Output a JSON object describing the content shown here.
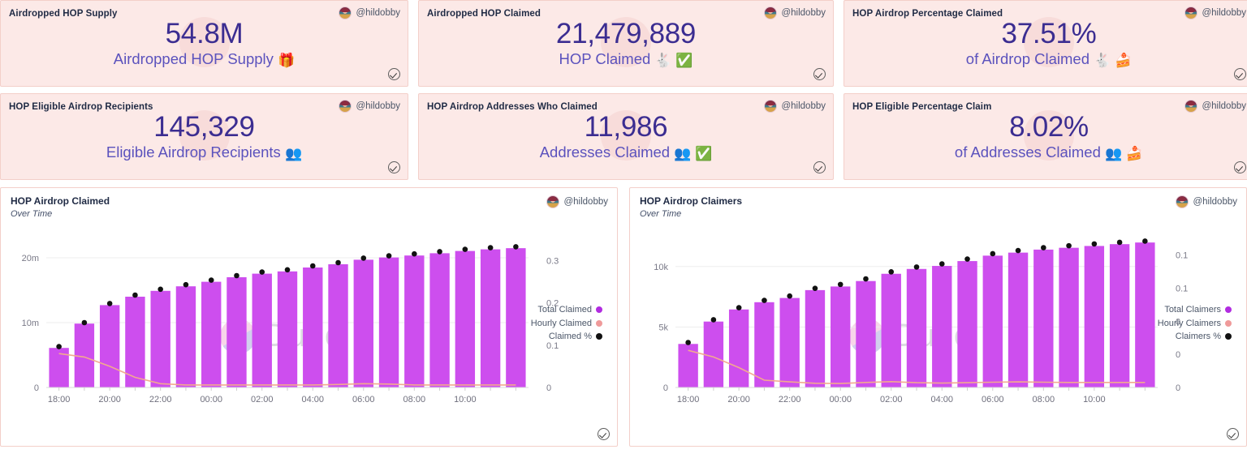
{
  "attribution": {
    "handle": "@hildobby",
    "avatar_icon": "user-avatar"
  },
  "kpis": [
    {
      "title": "Airdropped HOP Supply",
      "value": "54.8M",
      "subtitle": "Airdropped HOP Supply",
      "emojis": "🎁"
    },
    {
      "title": "Airdropped HOP Claimed",
      "value": "21,479,889",
      "subtitle": "HOP Claimed",
      "emojis": "🐇 ✅"
    },
    {
      "title": "HOP Airdrop Percentage Claimed",
      "value": "37.51%",
      "subtitle": "of Airdrop Claimed",
      "emojis": "🐇 🍰"
    },
    {
      "title": "HOP Eligible Airdrop Recipients",
      "value": "145,329",
      "subtitle": "Eligible Airdrop Recipients",
      "emojis": "👥"
    },
    {
      "title": "HOP Airdrop Addresses Who Claimed",
      "value": "11,986",
      "subtitle": "Addresses Claimed",
      "emojis": "👥 ✅"
    },
    {
      "title": "HOP Eligible Percentage Claim",
      "value": "8.02%",
      "subtitle": "of Addresses Claimed",
      "emojis": "👥 🍰"
    }
  ],
  "watermark": {
    "text": "Dune"
  },
  "colors": {
    "card_background": "#fce9e7",
    "card_border": "#f3cfc9",
    "value_text": "#3b2d91",
    "subtitle_text": "#5b52bd",
    "bar": "#cd4eee",
    "line": "#f2a98f",
    "dot": "#111111"
  },
  "charts": [
    {
      "title": "HOP Airdrop Claimed",
      "subtitle": "Over Time",
      "legend": [
        {
          "label": "Total Claimed",
          "color": "#b12ce0"
        },
        {
          "label": "Hourly Claimed",
          "color": "#ef9a9a"
        },
        {
          "label": "Claimed %",
          "color": "#111111"
        }
      ]
    },
    {
      "title": "HOP Airdrop Claimers",
      "subtitle": "Over Time",
      "legend": [
        {
          "label": "Total Claimers",
          "color": "#b12ce0"
        },
        {
          "label": "Hourly Claimers",
          "color": "#ef9a9a"
        },
        {
          "label": "Claimers %",
          "color": "#111111"
        }
      ]
    }
  ],
  "chart_data": [
    {
      "type": "bar",
      "title": "HOP Airdrop Claimed",
      "subtitle": "Over Time",
      "xlabel": "",
      "ylabel": "",
      "grid": true,
      "legend_position": "right",
      "x": [
        "18:00",
        "19:00",
        "20:00",
        "21:00",
        "22:00",
        "23:00",
        "00:00",
        "01:00",
        "02:00",
        "03:00",
        "04:00",
        "05:00",
        "06:00",
        "07:00",
        "08:00",
        "09:00",
        "10:00",
        "11:00",
        "12:00"
      ],
      "xtick_labels": [
        "18:00",
        "20:00",
        "22:00",
        "00:00",
        "02:00",
        "04:00",
        "06:00",
        "08:00",
        "10:00"
      ],
      "left_axis": {
        "ticks": [
          0,
          10000000,
          20000000
        ],
        "tick_labels": [
          "0",
          "10m",
          "20m"
        ],
        "range": [
          0,
          23500000
        ]
      },
      "right_axis": {
        "ticks": [
          0,
          0.1,
          0.2,
          0.3
        ],
        "tick_labels": [
          "0",
          "0.1",
          "0.2",
          "0.3"
        ],
        "range": [
          0,
          0.36
        ]
      },
      "series": [
        {
          "name": "Total Claimed",
          "type": "bar",
          "color": "#cd4eee",
          "axis": "left",
          "values": [
            6100000,
            9850000,
            12700000,
            14000000,
            14900000,
            15600000,
            16300000,
            17000000,
            17550000,
            17900000,
            18500000,
            19000000,
            19700000,
            20050000,
            20350000,
            20700000,
            21050000,
            21300000,
            21479889
          ]
        },
        {
          "name": "Hourly Claimed",
          "type": "line",
          "color": "#f2a98f",
          "axis": "right",
          "values": [
            0.08,
            0.072,
            0.05,
            0.024,
            0.009,
            0.006,
            0.006,
            0.006,
            0.006,
            0.006,
            0.006,
            0.007,
            0.009,
            0.008,
            0.006,
            0.006,
            0.006,
            0.006,
            0.006
          ]
        },
        {
          "name": "Claimed %",
          "type": "scatter",
          "color": "#111111",
          "axis": "left",
          "values": [
            6300000,
            10000000,
            12950000,
            14250000,
            15150000,
            15850000,
            16550000,
            17250000,
            17800000,
            18150000,
            18750000,
            19250000,
            19950000,
            20300000,
            20600000,
            20950000,
            21300000,
            21550000,
            21700000
          ]
        }
      ]
    },
    {
      "type": "bar",
      "title": "HOP Airdrop Claimers",
      "subtitle": "Over Time",
      "xlabel": "",
      "ylabel": "",
      "grid": true,
      "legend_position": "right",
      "x": [
        "18:00",
        "19:00",
        "20:00",
        "21:00",
        "22:00",
        "23:00",
        "00:00",
        "01:00",
        "02:00",
        "03:00",
        "04:00",
        "05:00",
        "06:00",
        "07:00",
        "08:00",
        "09:00",
        "10:00",
        "11:00",
        "12:00"
      ],
      "xtick_labels": [
        "18:00",
        "20:00",
        "22:00",
        "00:00",
        "02:00",
        "04:00",
        "06:00",
        "08:00",
        "10:00"
      ],
      "left_axis": {
        "ticks": [
          0,
          5000,
          10000
        ],
        "tick_labels": [
          "0",
          "5k",
          "10k"
        ],
        "range": [
          0,
          12600
        ]
      },
      "right_axis": {
        "ticks": [
          0,
          0.025,
          0.05,
          0.075,
          0.1
        ],
        "tick_labels": [
          "0",
          "0",
          "0",
          "0.1",
          "0.1"
        ],
        "range": [
          0,
          0.115
        ]
      },
      "series": [
        {
          "name": "Total Claimers",
          "type": "bar",
          "color": "#cd4eee",
          "axis": "left",
          "values": [
            3600,
            5450,
            6450,
            7050,
            7400,
            8050,
            8350,
            8800,
            9400,
            9800,
            10050,
            10450,
            10900,
            11150,
            11400,
            11550,
            11700,
            11850,
            11986
          ]
        },
        {
          "name": "Hourly Claimers",
          "type": "line",
          "color": "#f2a98f",
          "axis": "right",
          "values": [
            0.028,
            0.023,
            0.015,
            0.0055,
            0.0042,
            0.0032,
            0.003,
            0.0038,
            0.0044,
            0.0036,
            0.0033,
            0.0036,
            0.004,
            0.0042,
            0.004,
            0.0038,
            0.0038,
            0.0038,
            0.0038
          ]
        },
        {
          "name": "Claimers %",
          "type": "scatter",
          "color": "#111111",
          "axis": "left",
          "values": [
            3720,
            5600,
            6600,
            7200,
            7560,
            8200,
            8520,
            8980,
            9560,
            9960,
            10220,
            10620,
            11060,
            11320,
            11560,
            11720,
            11870,
            12000,
            12100
          ]
        }
      ]
    }
  ]
}
